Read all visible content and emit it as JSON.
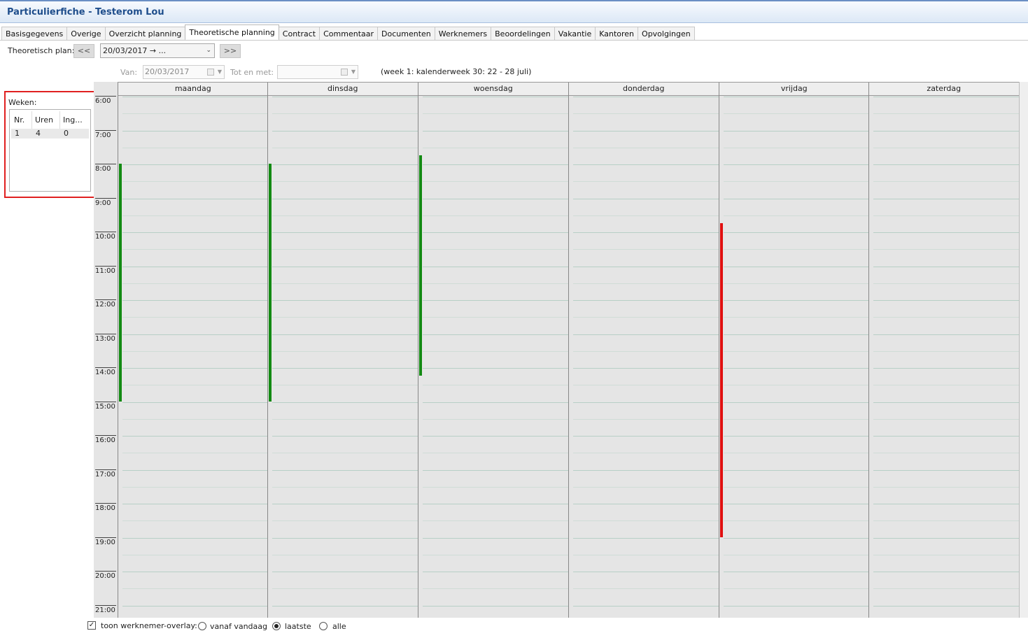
{
  "window": {
    "title": "Particulierfiche - Testerom Lou"
  },
  "tabs": [
    {
      "label": "Basisgegevens",
      "active": false
    },
    {
      "label": "Overige",
      "active": false
    },
    {
      "label": "Overzicht planning",
      "active": false
    },
    {
      "label": "Theoretische planning",
      "active": true
    },
    {
      "label": "Contract",
      "active": false
    },
    {
      "label": "Commentaar",
      "active": false
    },
    {
      "label": "Documenten",
      "active": false
    },
    {
      "label": "Werknemers",
      "active": false
    },
    {
      "label": "Beoordelingen",
      "active": false
    },
    {
      "label": "Vakantie",
      "active": false
    },
    {
      "label": "Kantoren",
      "active": false
    },
    {
      "label": "Opvolgingen",
      "active": false
    }
  ],
  "plan": {
    "label": "Theoretisch plan:",
    "prev_label": "<<",
    "next_label": ">>",
    "selected": "20/03/2017 → ...",
    "from_label": "Van:",
    "from_value": "20/03/2017",
    "to_label": "Tot en met:",
    "to_value": "",
    "week_info": "(week 1: kalenderweek 30: 22 - 28 juli)"
  },
  "weeks": {
    "label": "Weken:",
    "columns": [
      "Nr.",
      "Uren",
      "Ing..."
    ],
    "rows": [
      [
        "1",
        "4",
        "0"
      ]
    ]
  },
  "calendar": {
    "days": [
      "maandag",
      "dinsdag",
      "woensdag",
      "donderdag",
      "vrijdag",
      "zaterdag"
    ],
    "hours": [
      "6:00",
      "7:00",
      "8:00",
      "9:00",
      "10:00",
      "11:00",
      "12:00",
      "13:00",
      "14:00",
      "15:00",
      "16:00",
      "17:00",
      "18:00",
      "19:00",
      "20:00",
      "21:00"
    ],
    "bars": [
      {
        "day": "maandag",
        "start": 8.0,
        "end": 15.0,
        "color": "#138a13"
      },
      {
        "day": "dinsdag",
        "start": 8.0,
        "end": 15.0,
        "color": "#138a13"
      },
      {
        "day": "woensdag",
        "start": 7.75,
        "end": 14.25,
        "color": "#138a13"
      },
      {
        "day": "vrijdag",
        "start": 9.75,
        "end": 19.0,
        "color": "#e01010"
      }
    ]
  },
  "overlay": {
    "checkbox_label": "toon werknemer-overlay:",
    "checked": true,
    "options": [
      {
        "label": "vanaf vandaag",
        "selected": false
      },
      {
        "label": "laatste",
        "selected": true
      },
      {
        "label": "alle",
        "selected": false
      }
    ]
  }
}
